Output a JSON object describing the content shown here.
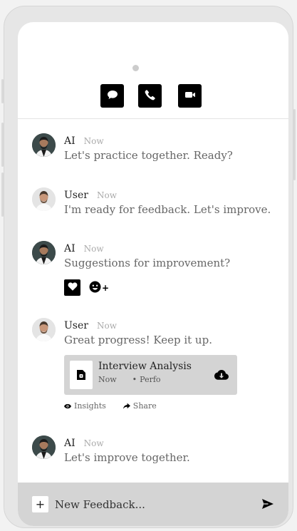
{
  "header": {
    "buttons": [
      {
        "icon": "chat-bubble-icon",
        "label": "Chat"
      },
      {
        "icon": "phone-icon",
        "label": "Call"
      },
      {
        "icon": "video-camera-icon",
        "label": "Video"
      }
    ]
  },
  "messages": [
    {
      "sender": "AI",
      "time": "Now",
      "text": "Let's practice together. Ready?"
    },
    {
      "sender": "User",
      "time": "Now",
      "text": "I'm ready for feedback. Let's improve."
    },
    {
      "sender": "AI",
      "time": "Now",
      "text": "Suggestions for improvement?",
      "reactions": {
        "heart_icon": "heart-icon",
        "add_icon": "add-reaction-icon",
        "add_symbol": "+"
      }
    },
    {
      "sender": "User",
      "time": "Now",
      "text": "Great progress! Keep it up.",
      "attachment": {
        "title": "Interview Analysis",
        "time": "Now",
        "separator": "•",
        "tag": "Perfo"
      },
      "actions": [
        {
          "label": "Insights",
          "icon": "eye-icon"
        },
        {
          "label": "Share",
          "icon": "share-arrow-icon"
        }
      ]
    },
    {
      "sender": "AI",
      "time": "Now",
      "text": "Let's improve together."
    }
  ],
  "composer": {
    "plus_symbol": "+",
    "placeholder": "New Feedback...",
    "send_icon": "send-icon"
  },
  "colors": {
    "accent": "#000000",
    "screen_bg": "#ffffff",
    "composer_bg": "#d4d4d4",
    "muted_text": "#666666",
    "timestamp": "#aaaaaa"
  }
}
